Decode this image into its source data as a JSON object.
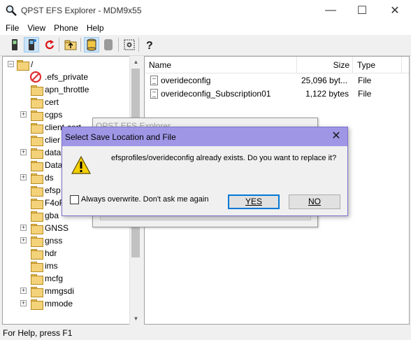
{
  "window": {
    "title": "QPST EFS Explorer - MDM9x55"
  },
  "menu": [
    "File",
    "View",
    "Phone",
    "Help"
  ],
  "toolbar": {
    "icons": [
      "phone-icon",
      "phone-connected-icon",
      "refresh-icon",
      "up-folder-icon",
      "drive-icon",
      "drive-disabled-icon",
      "settings-icon",
      "help-icon"
    ]
  },
  "tree": {
    "root": "/",
    "items": [
      ".efs_private",
      "apn_throttle",
      "cert",
      "cgps",
      "client-cert",
      "clier",
      "data",
      "Data",
      "ds",
      "efsp",
      "F4oF",
      "gba",
      "GNSS",
      "gnss",
      "hdr",
      "ims",
      "mcfg",
      "mmgsdi",
      "mmode"
    ]
  },
  "list": {
    "columns": [
      "Name",
      "Size",
      "Type"
    ],
    "rows": [
      {
        "name": "overideconfig",
        "size": "25,096 byt...",
        "type": "File"
      },
      {
        "name": "overideconfig_Subscription01",
        "size": "1,122 bytes",
        "type": "File"
      }
    ]
  },
  "ghost": {
    "title": "QPST EFS Explorer"
  },
  "dialog": {
    "title": "Select Save Location and File",
    "message": "efsprofiles/overideconfig already exists. Do you want to replace it?",
    "checkbox_label": "Always overwrite. Don't ask me again",
    "yes_label": "YES",
    "no_label": "NO"
  },
  "status": "For Help, press F1",
  "colors": {
    "dialog_title": "#9f97e6",
    "dialog_border": "#7a6fc9",
    "accent": "#0078d7"
  }
}
